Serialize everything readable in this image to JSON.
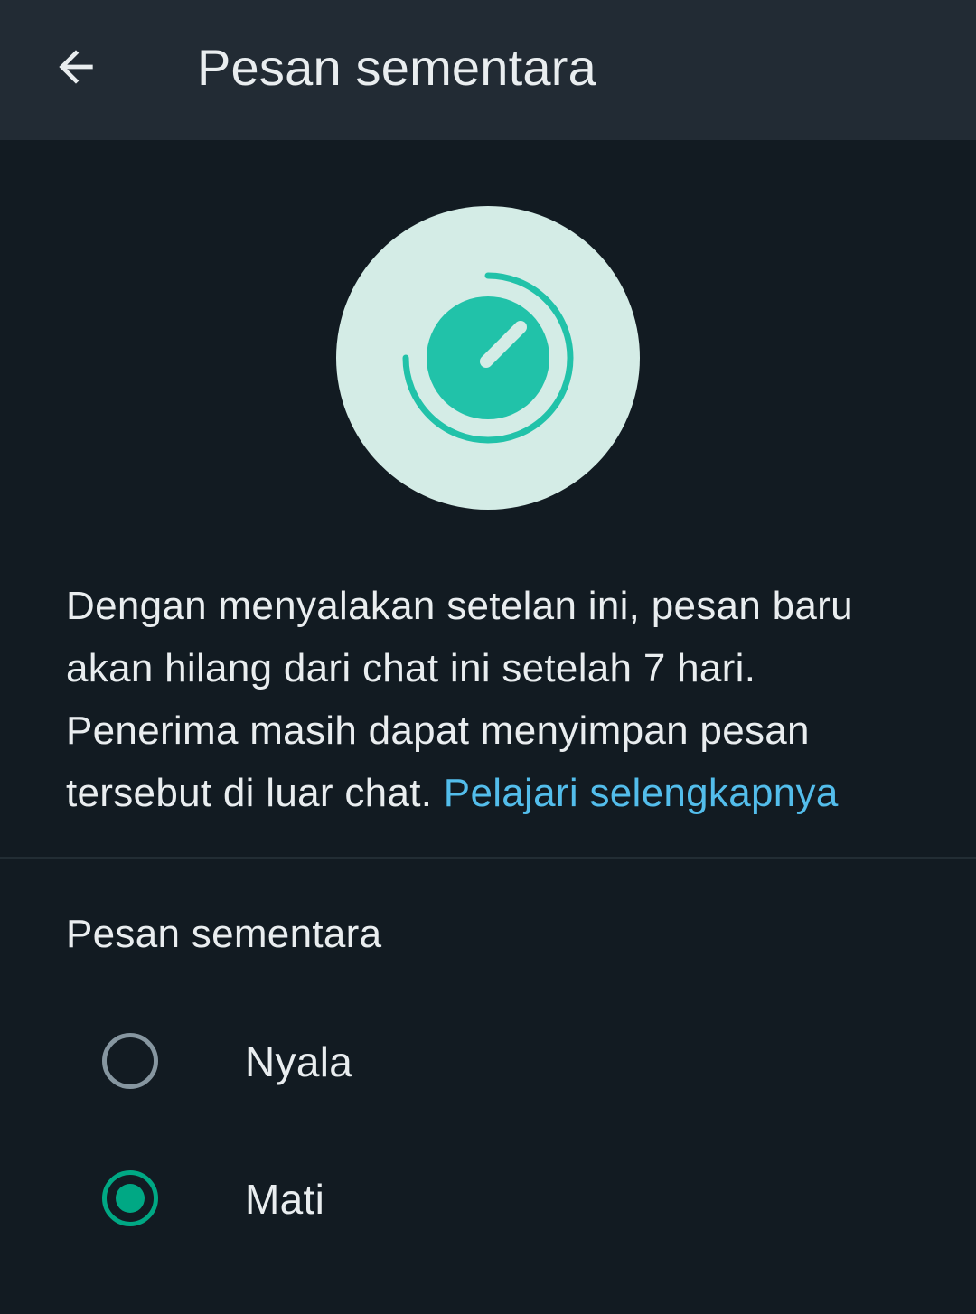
{
  "appbar": {
    "title": "Pesan sementara",
    "back_icon": "arrow-back-icon"
  },
  "hero": {
    "icon": "disappearing-timer-icon",
    "circle_color": "#d4ece6",
    "icon_color": "#21c2a9"
  },
  "description": {
    "text": "Dengan menyalakan setelan ini, pesan baru akan hilang dari chat ini setelah 7 hari. Penerima masih dapat menyimpan pesan tersebut di luar chat.",
    "link": "Pelajari selengkapnya"
  },
  "section": {
    "title": "Pesan sementara"
  },
  "options": [
    {
      "label": "Nyala",
      "selected": false
    },
    {
      "label": "Mati",
      "selected": true
    }
  ],
  "colors": {
    "background": "#121b22",
    "appbar": "#222b34",
    "accent": "#00a884",
    "link": "#53bdeb",
    "text": "#e9edef"
  }
}
